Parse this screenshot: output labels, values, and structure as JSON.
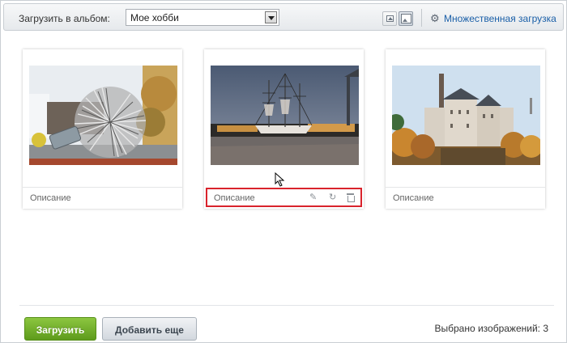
{
  "toolbar": {
    "upload_to_album_label": "Загрузить в альбом:",
    "album_selected": "Мое хобби",
    "view_small_icon": "small-thumbnails-icon",
    "view_large_icon": "large-thumbnails-icon",
    "multi_upload_icon": "gear-icon",
    "multi_upload_label": "Множественная загрузка"
  },
  "photos": [
    {
      "description": "Описание",
      "subject": "wire ball sculpture"
    },
    {
      "description": "Описание",
      "subject": "tall ship at harbor",
      "actions": [
        "pencil-icon",
        "rotate-icon",
        "trash-icon"
      ],
      "highlighted": true
    },
    {
      "description": "Описание",
      "subject": "stone castle"
    }
  ],
  "footer": {
    "upload_label": "Загрузить",
    "add_more_label": "Добавить еще",
    "selected_count_text": "Выбрано изображений: 3"
  },
  "colors": {
    "link": "#1a5fa8",
    "upload_button": "#6fab28",
    "highlight_border": "#d9232c"
  }
}
